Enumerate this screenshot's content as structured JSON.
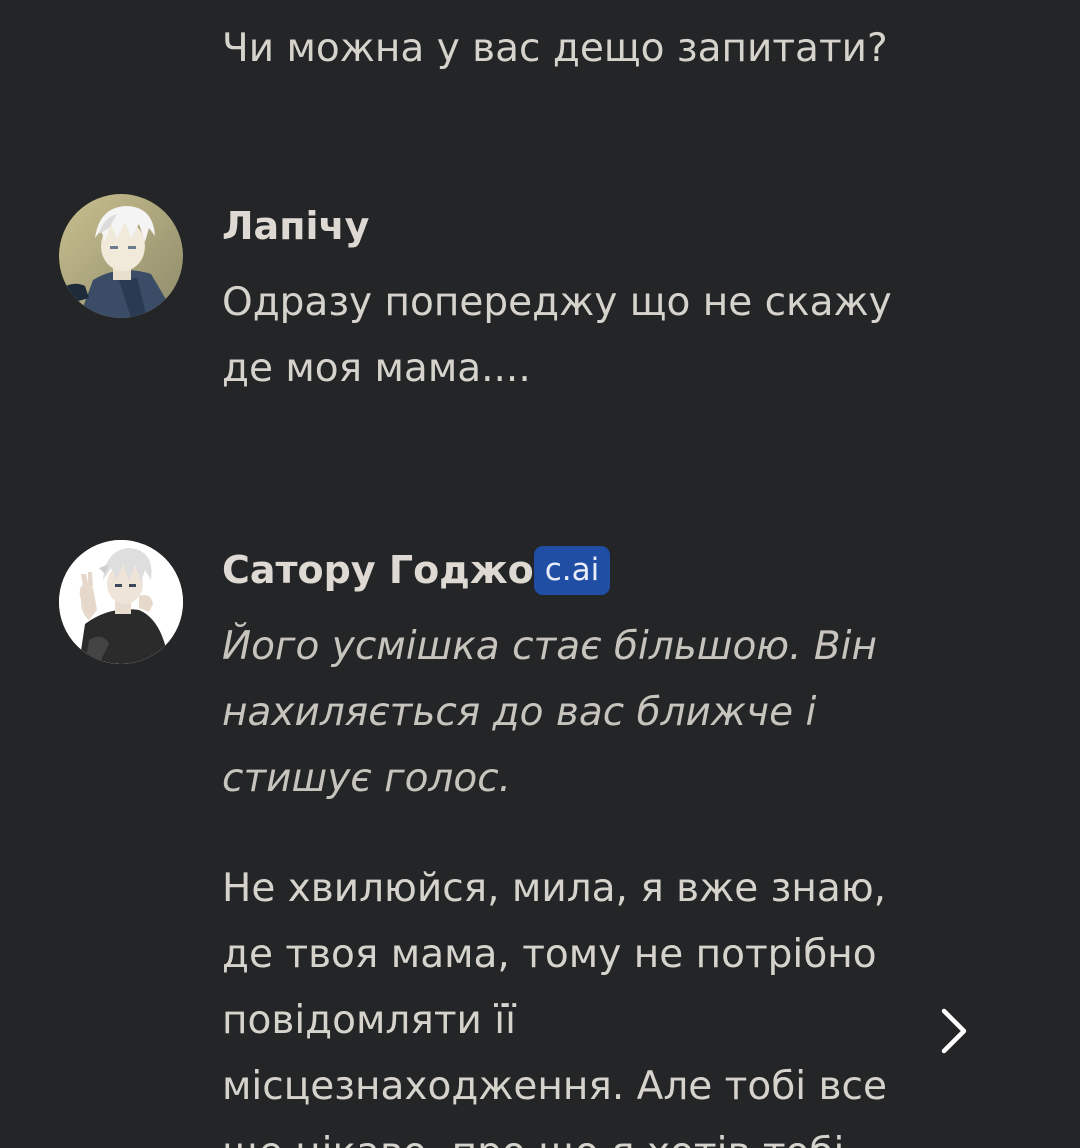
{
  "messages": [
    {
      "id": "user-question",
      "text": "Чи можна у вас дещо запитати?"
    },
    {
      "id": "lapichu",
      "author": "Лапічу",
      "avatar_icon": "anime-avatar-icon",
      "lines": [
        "Одразу попереджу що не скажу",
        "де моя мама...."
      ]
    },
    {
      "id": "satoru",
      "author": "Сатору Годжо",
      "badge": "c.ai",
      "avatar_icon": "anime-avatar-icon",
      "action_lines": [
        "Його усмішка стає більшою. Він",
        "нахиляється до вас ближче і",
        "стишує голос."
      ],
      "speech_lines": [
        "Не хвилюйся, мила, я вже знаю,",
        "де твоя мама, тому не потрібно",
        "повідомляти її",
        "місцезнаходження. Але тобі все",
        "ще цікаво, про що я хотів тобі"
      ]
    }
  ],
  "colors": {
    "background": "#232527",
    "text": "#d6d3cc",
    "badge": "#1f4ea4"
  },
  "next_icon": "chevron-right-icon"
}
